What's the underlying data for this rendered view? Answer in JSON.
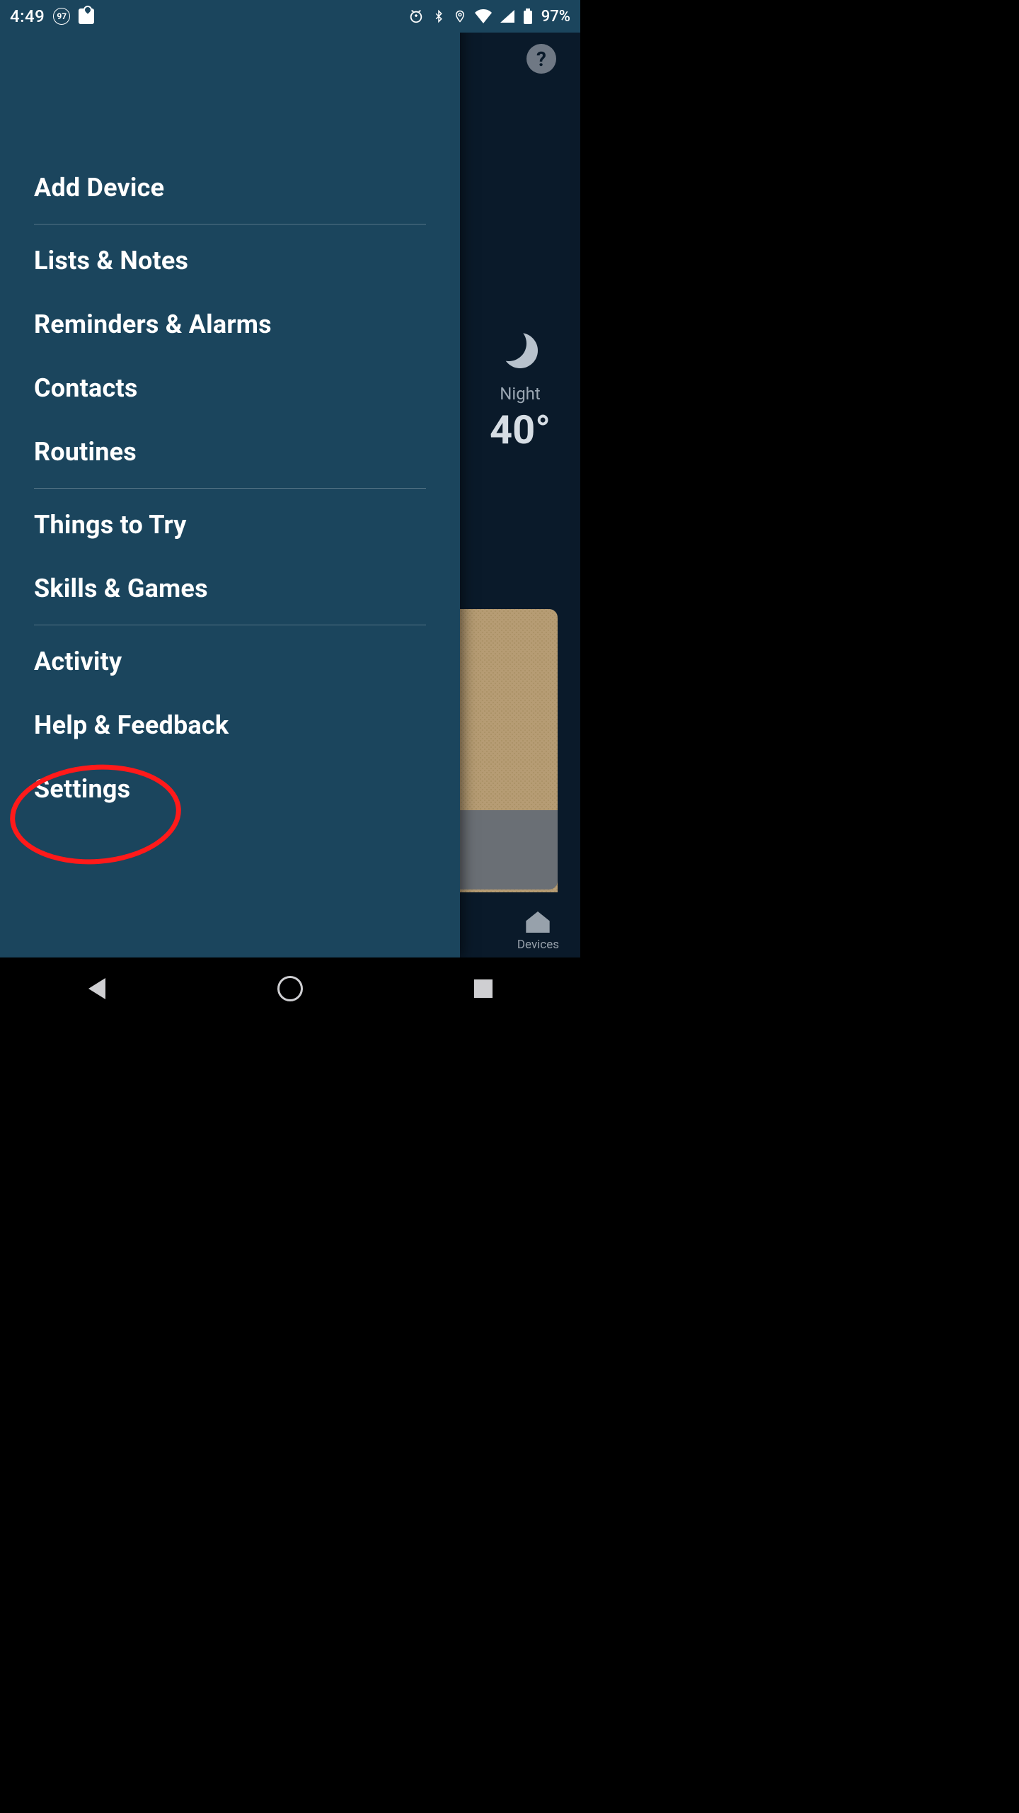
{
  "status": {
    "time": "4:49",
    "badge_number": "97",
    "battery_pct": "97%"
  },
  "background": {
    "help_glyph": "?",
    "night_label": "Night",
    "temperature": "40°",
    "bottom_tab_label": "Devices"
  },
  "drawer": {
    "items": [
      {
        "label": "Add Device",
        "divider": true
      },
      {
        "label": "Lists & Notes",
        "divider": false
      },
      {
        "label": "Reminders & Alarms",
        "divider": false
      },
      {
        "label": "Contacts",
        "divider": false
      },
      {
        "label": "Routines",
        "divider": true
      },
      {
        "label": "Things to Try",
        "divider": false
      },
      {
        "label": "Skills & Games",
        "divider": true
      },
      {
        "label": "Activity",
        "divider": false
      },
      {
        "label": "Help & Feedback",
        "divider": false
      },
      {
        "label": "Settings",
        "divider": false
      }
    ]
  },
  "annotation": {
    "highlighted_item": "Settings"
  }
}
